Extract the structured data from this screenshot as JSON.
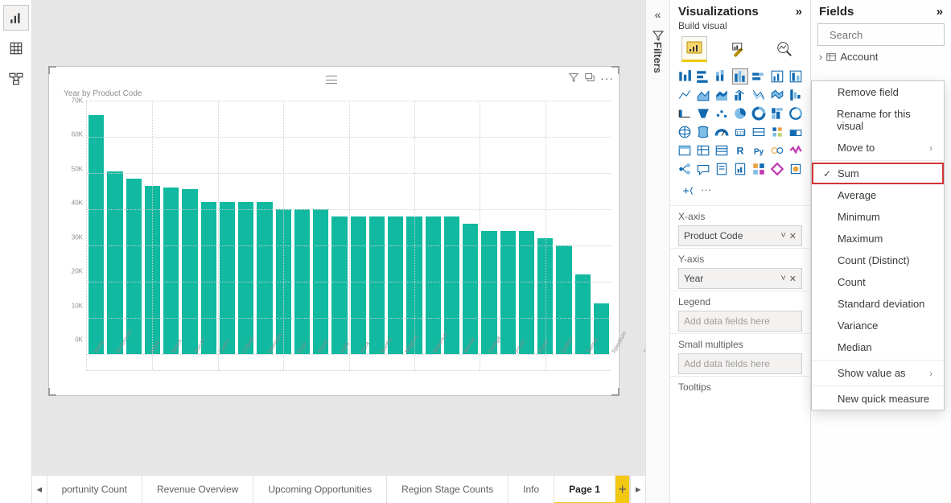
{
  "left_rail": {
    "report": "report-view",
    "data": "data-view",
    "model": "model-view"
  },
  "pages": {
    "tabs": [
      "portunity Count",
      "Revenue Overview",
      "Upcoming Opportunities",
      "Region Stage Counts",
      "Info",
      "Page 1"
    ],
    "active_index": 5
  },
  "visual": {
    "title": "Year by Product Code",
    "header_icons": [
      "filter",
      "focus",
      "more"
    ]
  },
  "chart_data": {
    "type": "bar",
    "title": "Year by Product Code",
    "xlabel": "Product Code",
    "ylabel": "Year",
    "ylim": [
      0,
      70000
    ],
    "yticks": [
      "0K",
      "10K",
      "20K",
      "30K",
      "40K",
      "50K",
      "60K",
      "70K"
    ],
    "categories": [
      "Retro",
      "Accessory",
      "Aqua",
      "Artem",
      "Aurum",
      "Ceres",
      "Collum",
      "Dominus",
      "Ergo",
      "Fama",
      "Felis",
      "Hera",
      "Kontra",
      "Magnus",
      "Maximus",
      "Mensa",
      "Omega",
      "Pirum",
      "Primo",
      "Quibus",
      "Salvus",
      "Spectrum",
      "Stratum",
      "Talos",
      "Tempo",
      "Triton",
      "Universum",
      "Chronos"
    ],
    "values": [
      66000,
      50500,
      48500,
      46500,
      46000,
      45500,
      42000,
      42000,
      42000,
      42000,
      40000,
      40000,
      40000,
      38000,
      38000,
      38000,
      38000,
      38000,
      38000,
      38000,
      36000,
      34000,
      34000,
      34000,
      32000,
      30000,
      22000,
      14000
    ]
  },
  "viz_pane": {
    "title": "Visualizations",
    "subtitle": "Build visual",
    "modes": [
      "build",
      "format",
      "analytics"
    ],
    "xaxis_label": "X-axis",
    "xaxis_field": "Product Code",
    "yaxis_label": "Y-axis",
    "yaxis_field": "Year",
    "legend_label": "Legend",
    "legend_placeholder": "Add data fields here",
    "small_mult_label": "Small multiples",
    "small_mult_placeholder": "Add data fields here",
    "tooltips_label": "Tooltips"
  },
  "fields_pane": {
    "title": "Fields",
    "search_placeholder": "Search",
    "tree": [
      {
        "label": "Account"
      }
    ]
  },
  "filters_rail": {
    "label": "Filters"
  },
  "context_menu": {
    "items": [
      {
        "label": "Remove field"
      },
      {
        "label": "Rename for this visual"
      },
      {
        "label": "Move to",
        "arrow": true
      },
      {
        "sep": true
      },
      {
        "label": "Sum",
        "checked": true,
        "highlight": true
      },
      {
        "label": "Average"
      },
      {
        "label": "Minimum"
      },
      {
        "label": "Maximum"
      },
      {
        "label": "Count (Distinct)"
      },
      {
        "label": "Count"
      },
      {
        "label": "Standard deviation"
      },
      {
        "label": "Variance"
      },
      {
        "label": "Median"
      },
      {
        "sep": true
      },
      {
        "label": "Show value as",
        "arrow": true
      },
      {
        "sep": true
      },
      {
        "label": "New quick measure"
      }
    ]
  }
}
